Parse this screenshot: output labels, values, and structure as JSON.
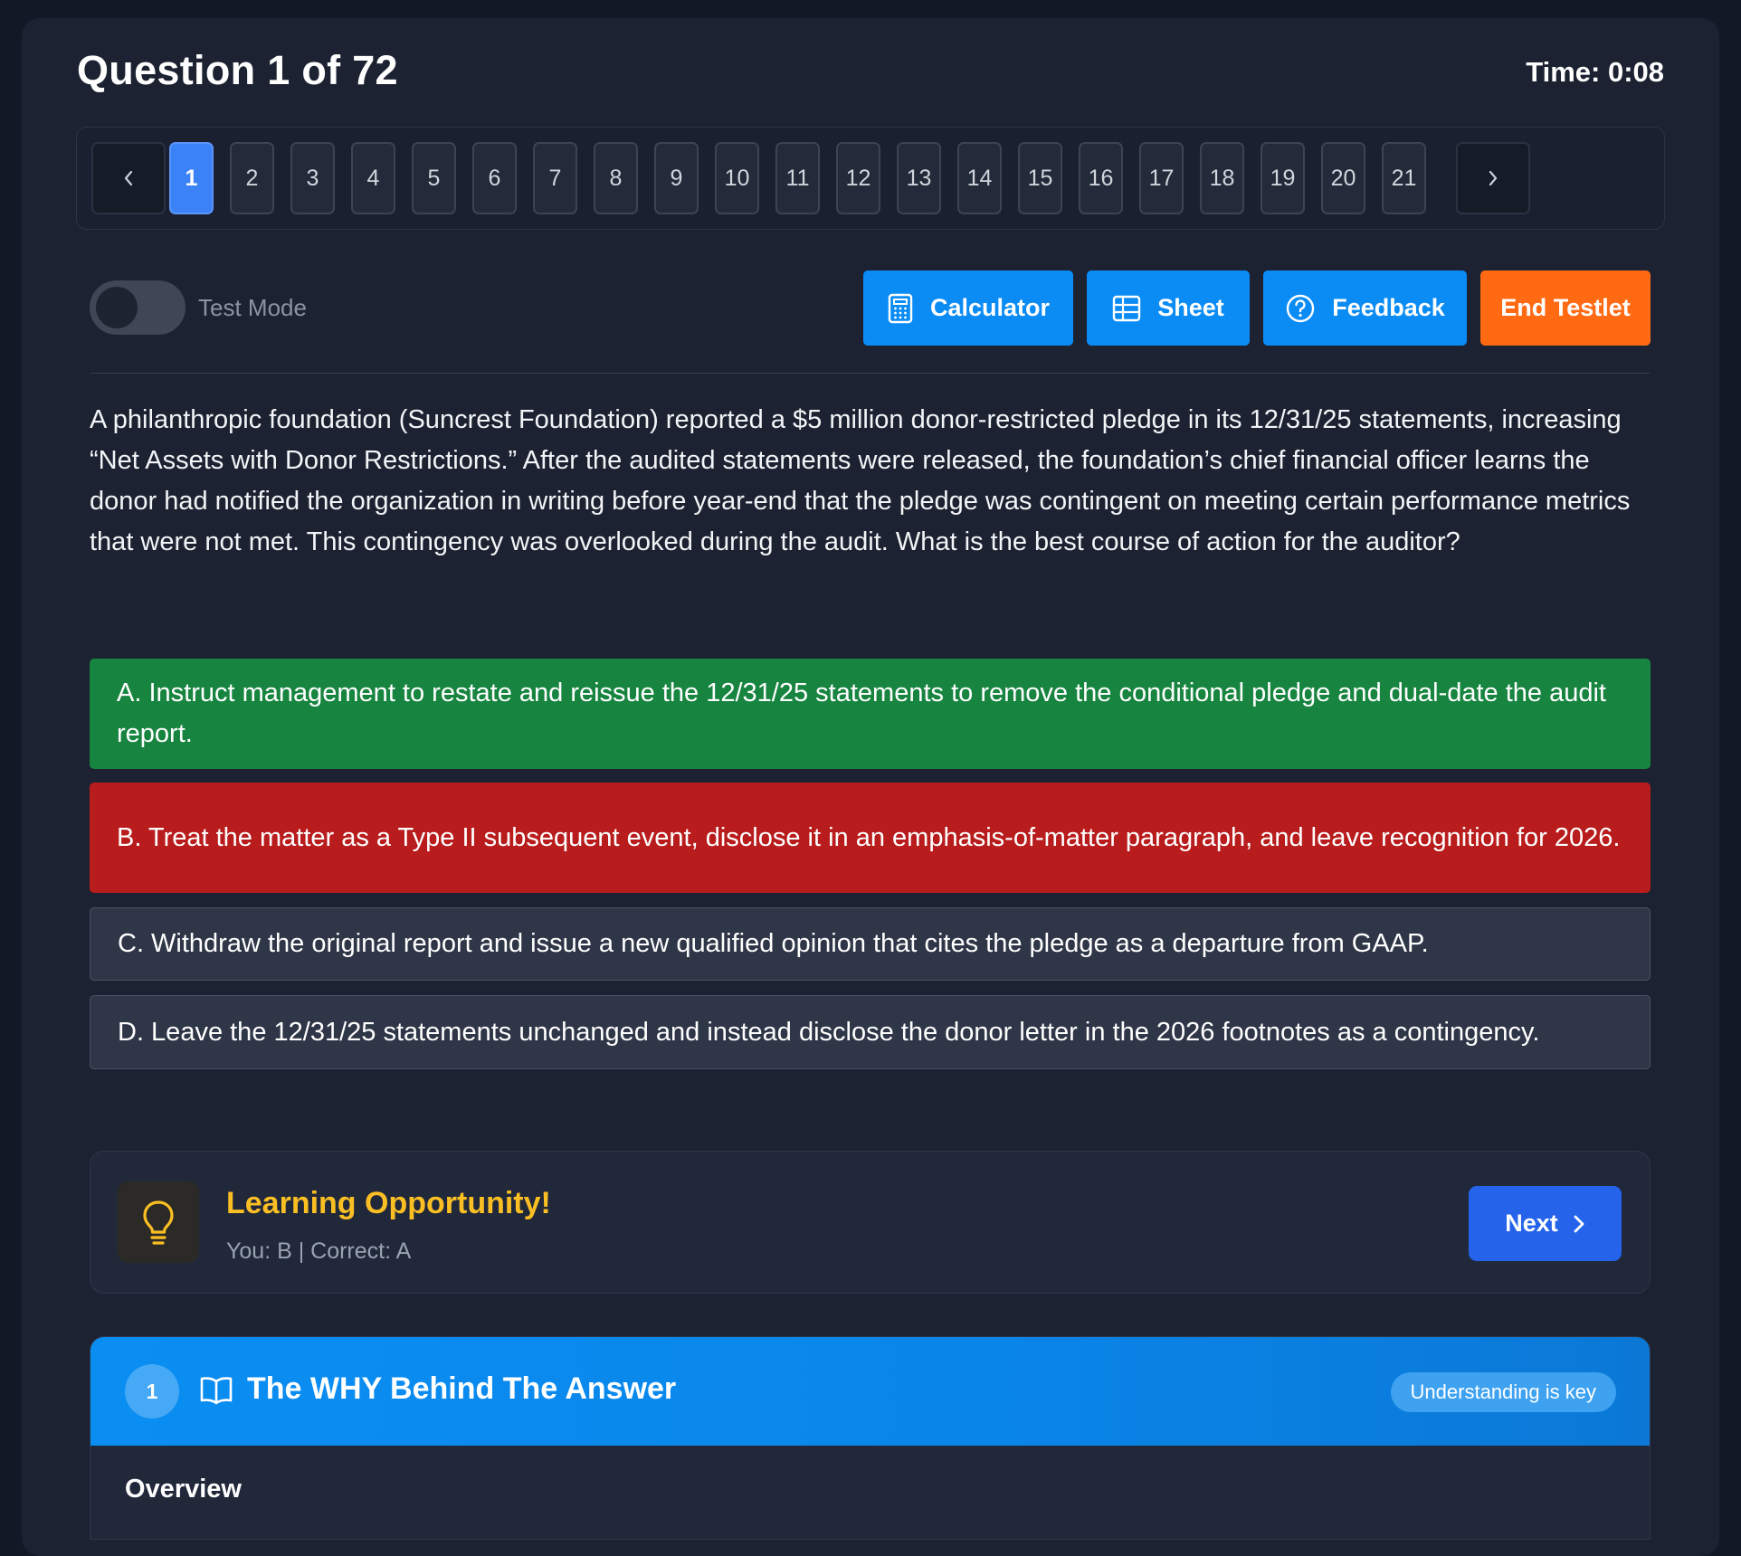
{
  "header": {
    "title": "Question 1 of 72",
    "timer": "Time: 0:08"
  },
  "pager": {
    "prev_icon": "chevron-left-icon",
    "next_icon": "chevron-right-icon",
    "pages": [
      "1",
      "2",
      "3",
      "4",
      "5",
      "6",
      "7",
      "8",
      "9",
      "10",
      "11",
      "12",
      "13",
      "14",
      "15",
      "16",
      "17",
      "18",
      "19",
      "20",
      "21"
    ],
    "active": "1"
  },
  "toolbar": {
    "test_mode_label": "Test Mode",
    "test_mode_on": false,
    "calculator_label": "Calculator",
    "sheet_label": "Sheet",
    "feedback_label": "Feedback",
    "end_label": "End Testlet"
  },
  "question": {
    "text": "A philanthropic foundation (Suncrest Foundation) reported a $5 million donor-restricted pledge in its 12/31/25 statements, increasing “Net Assets with Donor Restrictions.” After the audited statements were released, the foundation’s chief financial officer learns the donor had notified the organization in writing before year-end that the pledge was contingent on meeting certain performance metrics that were not met. This contingency was overlooked during the audit. What is the best course of action for the auditor?"
  },
  "choices": [
    {
      "text": "A. Instruct management to restate and reissue the 12/31/25 statements to remove the conditional pledge and dual-date the audit report.",
      "state": "correct"
    },
    {
      "text": "B. Treat the matter as a Type II subsequent event, disclose it in an emphasis-of-matter paragraph, and leave recognition for 2026.",
      "state": "wrong"
    },
    {
      "text": "C. Withdraw the original report and issue a new qualified opinion that cites the pledge as a departure from GAAP.",
      "state": "plain"
    },
    {
      "text": "D. Leave the 12/31/25 statements unchanged and instead disclose the donor letter in the 2026 footnotes as a contingency.",
      "state": "plain"
    }
  ],
  "result": {
    "icon": "lightbulb-icon",
    "title": "Learning Opportunity!",
    "subtitle": "You: B | Correct: A",
    "next_label": "Next"
  },
  "explanation": {
    "number": "1",
    "icon": "book-open-icon",
    "title": "The WHY Behind The Answer",
    "badge": "Understanding is key",
    "section_heading": "Overview"
  },
  "colors": {
    "correct": "#178540",
    "wrong": "#b91c1c",
    "accent_blue": "#0b8cf5",
    "end_orange": "#ff6a13",
    "warning_yellow": "#fbbf24"
  }
}
